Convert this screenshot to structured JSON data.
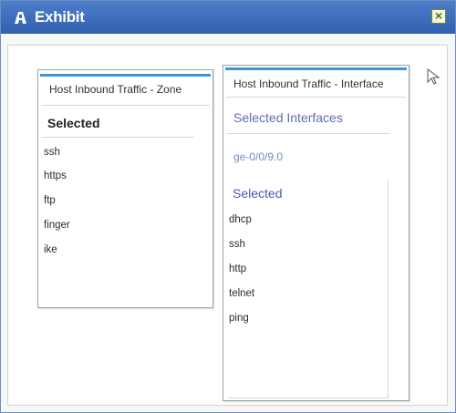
{
  "window": {
    "title": "Exhibit"
  },
  "zone_panel": {
    "title": "Host Inbound Traffic - Zone",
    "selected_header": "Selected",
    "items": [
      "ssh",
      "https",
      "ftp",
      "finger",
      "ike"
    ]
  },
  "interface_panel": {
    "title": "Host Inbound Traffic - Interface",
    "selected_interfaces_label": "Selected Interfaces",
    "interface_value": "ge-0/0/9.0",
    "selected_header": "Selected",
    "items": [
      "dhcp",
      "ssh",
      "http",
      "telnet",
      "ping"
    ]
  },
  "colors": {
    "titlebar": "#3a6bbd",
    "accent": "#3d94d6",
    "link": "#5d6fb0"
  },
  "icons": [
    "exhibit-icon",
    "close-icon",
    "cursor-icon"
  ]
}
